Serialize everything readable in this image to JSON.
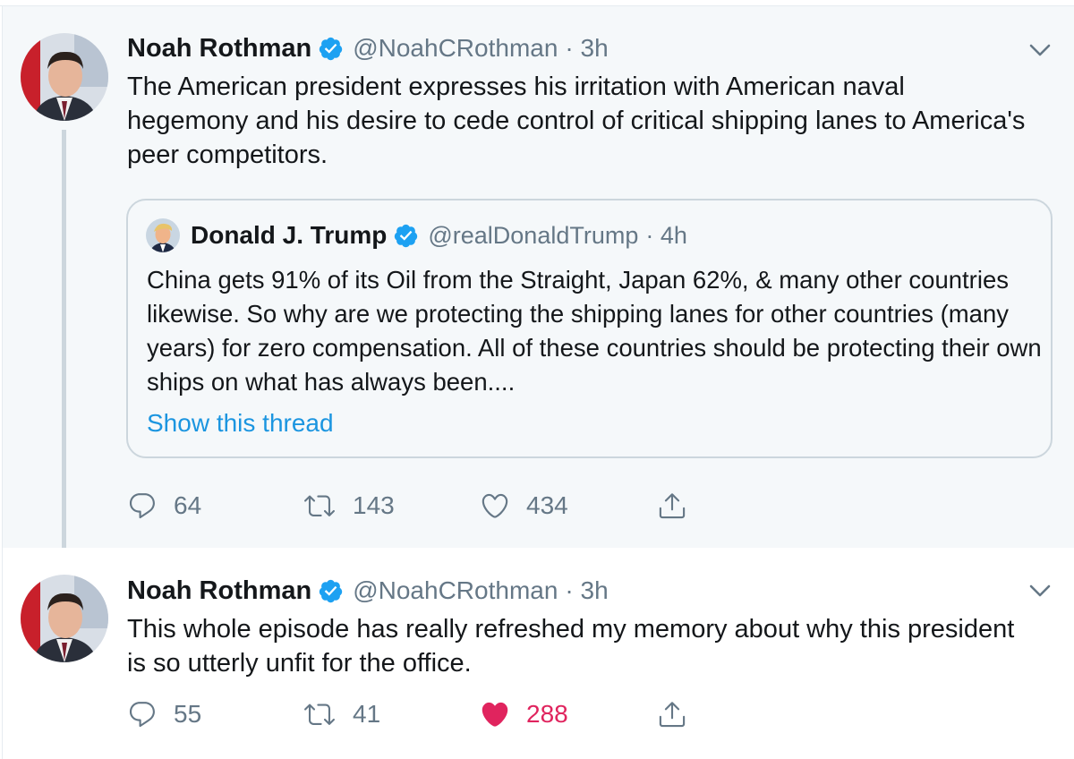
{
  "colors": {
    "thread_bg": "#f5f8fa",
    "text": "#14171a",
    "muted": "#657786",
    "link": "#1b95e0",
    "verified": "#1da1f2",
    "like_active": "#e0245e",
    "border": "#ccd6dd"
  },
  "tweets": [
    {
      "name": "Noah Rothman",
      "handle": "@NoahCRothman",
      "time": "· 3h",
      "text": "The American president expresses his irritation with American naval hegemony and his desire to cede control of critical shipping lanes to America's peer competitors.",
      "quoted": {
        "name": "Donald J. Trump",
        "handle": "@realDonaldTrump",
        "time": "· 4h",
        "text": "China gets 91% of its Oil from the Straight, Japan 62%, & many other countries likewise. So why are we protecting the shipping lanes for other countries (many years) for zero compensation. All of these countries should be protecting their own ships on what has always been....",
        "show_thread": "Show this thread"
      },
      "replies": "64",
      "retweets": "143",
      "likes": "434",
      "liked": false
    },
    {
      "name": "Noah Rothman",
      "handle": "@NoahCRothman",
      "time": "· 3h",
      "text": "This whole episode has really refreshed my memory about why this president is so utterly unfit for the office.",
      "replies": "55",
      "retweets": "41",
      "likes": "288",
      "liked": true
    }
  ],
  "icons": {
    "verified": "verified-badge-icon",
    "caret": "chevron-down-icon",
    "reply": "reply-icon",
    "retweet": "retweet-icon",
    "like": "heart-icon",
    "share": "share-icon"
  }
}
